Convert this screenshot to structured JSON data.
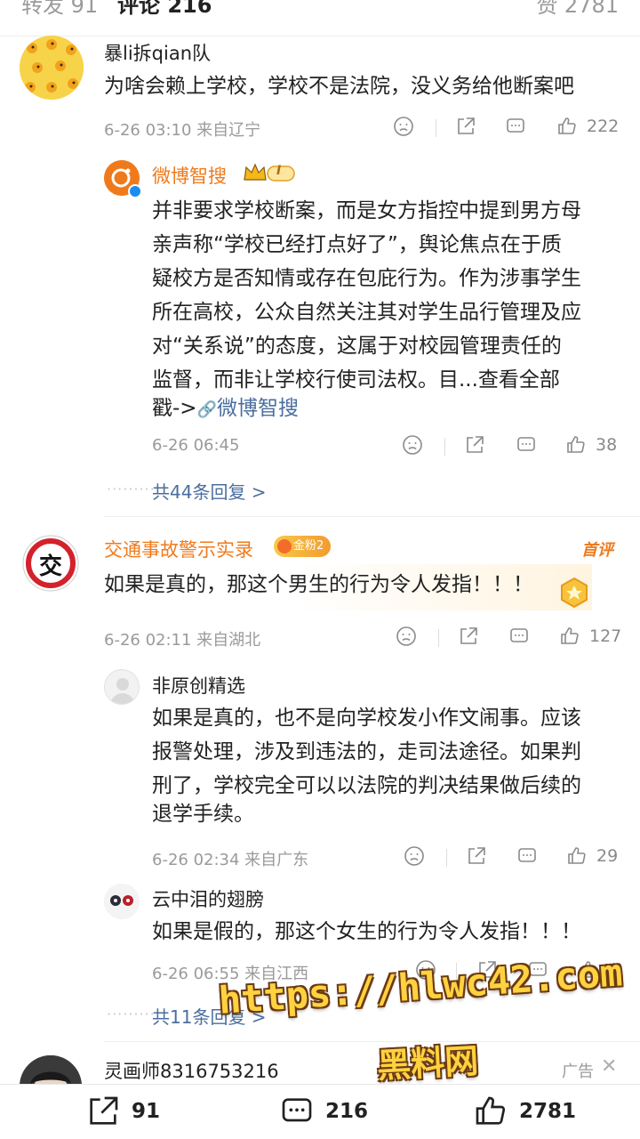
{
  "tabs": {
    "repost": "转发 91",
    "comments": "评论 216",
    "likes": "赞 2781"
  },
  "comments": [
    {
      "user": "暴li拆qian队",
      "text": "为啥会赖上学校，学校不是法院，没义务给他断案吧",
      "time_loc": "6-26 03:10 来自辽宁",
      "likes": "222"
    },
    {
      "user": "微博智搜",
      "badge": "I",
      "text_lines": [
        "并非要求学校断案，而是女方指控中提到男方母",
        "亲声称“学校已经打点好了”，舆论焦点在于质",
        "疑校方是否知情或存在包庇行为。作为涉事学生",
        "所在高校，公众自然关注其对学生品行管理及应",
        "对“关系说”的态度，这属于对校园管理责任的",
        "监督，而非让学校行使司法权。目...查看全部",
        "戳->"
      ],
      "link": "微博智搜",
      "time_loc": "6-26 06:45",
      "likes": "38",
      "more": "共44条回复 >"
    },
    {
      "user": "交通事故警示实录",
      "avatar_char": "交",
      "fan_badge": "金粉2",
      "first_tag": "首评",
      "text": "如果是真的，那这个男生的行为令人发指！！！",
      "time_loc": "6-26 02:11 来自湖北",
      "likes": "127"
    },
    {
      "user": "非原创精选",
      "text_lines": [
        "如果是真的，也不是向学校发小作文闹事。应该",
        "报警处理，涉及到违法的，走司法途径。如果判",
        "刑了，学校完全可以以法院的判决结果做后续的",
        "退学手续。"
      ],
      "time_loc": "6-26 02:34 来自广东",
      "likes": "29"
    },
    {
      "user": "云中泪的翅膀",
      "text": "如果是假的，那这个女生的行为令人发指！！！",
      "time_loc": "6-26 06:55 来自江西",
      "likes": "6",
      "more": "共11条回复 >"
    },
    {
      "user": "灵画师8316753216",
      "ad": "广告"
    }
  ],
  "watermark": {
    "line1": "https://hlwc42.com",
    "line2": "黑料网"
  },
  "bottom_bar": {
    "reposts": "91",
    "comments": "216",
    "likes": "2781"
  },
  "colors": {
    "link": "#4a6e9f",
    "brand_orange": "#f07a1b",
    "meta_gray": "#9a9a9a"
  }
}
